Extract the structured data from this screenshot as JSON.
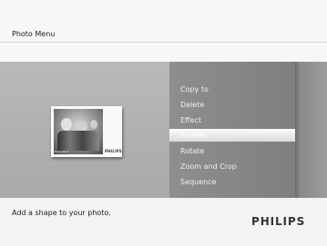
{
  "header": {
    "title": "Photo Menu"
  },
  "menu": {
    "items": [
      {
        "label": "Copy to"
      },
      {
        "label": "Delete"
      },
      {
        "label": "Effect"
      },
      {
        "label": "Frames"
      },
      {
        "label": "Rotate"
      },
      {
        "label": "Zoom and Crop"
      },
      {
        "label": "Sequence"
      }
    ],
    "selected": "Frames"
  },
  "preview": {
    "caption": "Every future",
    "brand": "PHILIPS"
  },
  "footer": {
    "hint": "Add a shape to your photo.",
    "brand": "PHILIPS"
  },
  "colors": {
    "selection": "#e9e9e9",
    "menu_panel": "#878787",
    "body_band": "#b3b3b3"
  }
}
